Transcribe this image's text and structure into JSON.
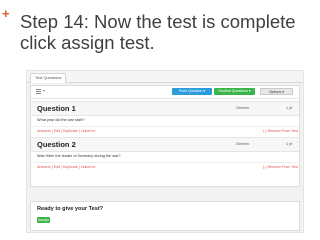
{
  "slide": {
    "title": "Step 14: Now the test is complete click assign test.",
    "accent": "#e05a2a"
  },
  "app": {
    "tab_label": "Test Questions",
    "toolbar": {
      "view_icon": "list-icon",
      "from_question_label": "From Question",
      "student_questions_label": "Student Questions",
      "options_label": "Options"
    },
    "questions": [
      {
        "title": "Question 1",
        "type": "Generic",
        "points": "1 pt",
        "text": "What year did the war start?",
        "links": "Answers | Edit | Duplicate | Linked to",
        "remove": "(-) Remove From Test"
      },
      {
        "title": "Question 2",
        "type": "Generic",
        "points": "1 pt",
        "text": "Was Hitler the leader of Germany during the war?",
        "links": "Answers | Edit | Duplicate | Linked to",
        "remove": "(-) Remove From Test"
      }
    ],
    "ready_title": "Ready to give your Test?",
    "assign_label": "Assign",
    "colors": {
      "blue": "#2d9cdb",
      "green": "#3bb54a",
      "link_red": "#e05050"
    }
  }
}
